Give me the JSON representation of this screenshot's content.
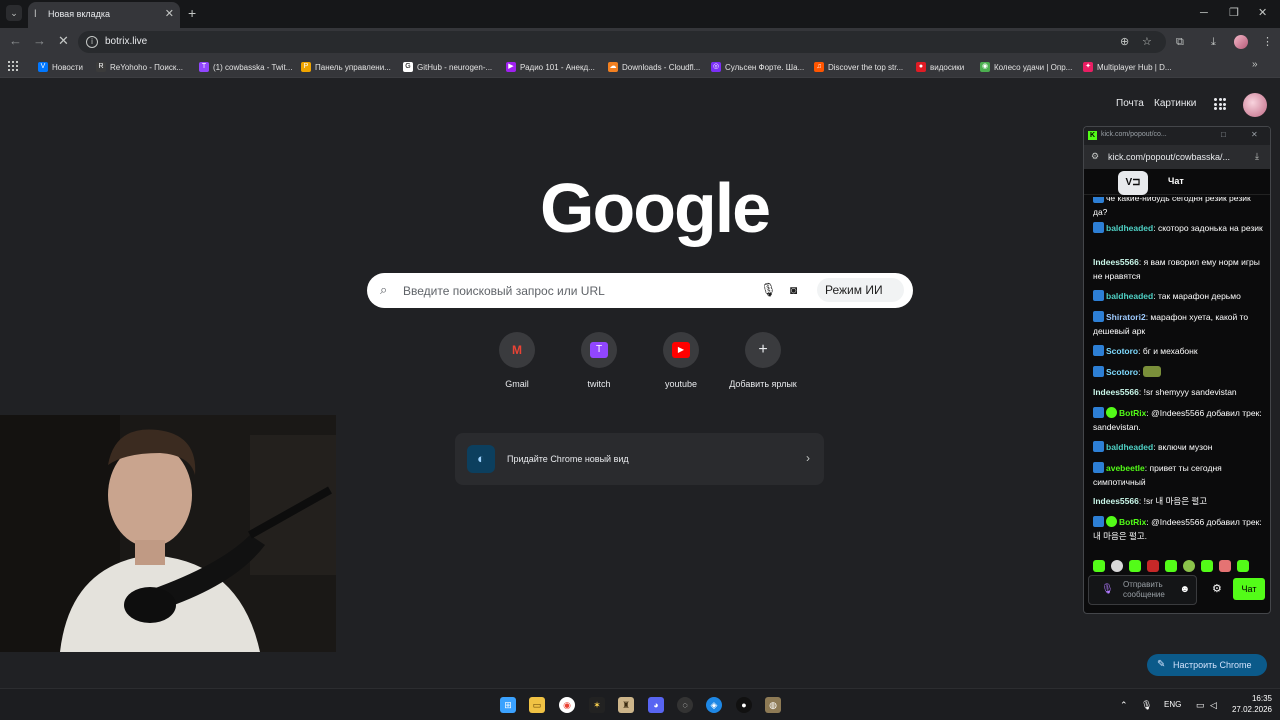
{
  "browser": {
    "tab_title": "Новая вкладка",
    "tab_close": "✕",
    "new_tab": "+",
    "win_min": "─",
    "win_max": "❐",
    "win_close": "✕",
    "url": "botrix.live",
    "back": "←",
    "forward": "→",
    "stop": "✕"
  },
  "bookmarks": [
    {
      "label": "Новости",
      "icon_color": "#0077ff",
      "icon": "VK"
    },
    {
      "label": "ReYohoho - Поиск...",
      "icon_color": "#3b3b3b",
      "icon": "R"
    },
    {
      "label": "(1) cowbasska - Twit...",
      "icon_color": "#9146ff",
      "icon": "T"
    },
    {
      "label": "Панель управлени...",
      "icon_color": "#f0a500",
      "icon": "P"
    },
    {
      "label": "GitHub - neurogen-...",
      "icon_color": "#ffffff",
      "icon": "G"
    },
    {
      "label": "Радио 101 - Анекд...",
      "icon_color": "#a020f0",
      "icon": "▶"
    },
    {
      "label": "Downloads - Cloudfl...",
      "icon_color": "#f38020",
      "icon": "☁"
    },
    {
      "label": "Сульсен Форте. Ша...",
      "icon_color": "#7b2ff7",
      "icon": "◎"
    },
    {
      "label": "Discover the top str...",
      "icon_color": "#ff5500",
      "icon": "♫"
    },
    {
      "label": "видосики",
      "icon_color": "#e01b24",
      "icon": "●"
    },
    {
      "label": "Колесо удачи | Опр...",
      "icon_color": "#4caf50",
      "icon": "◉"
    },
    {
      "label": "Multiplayer Hub | D...",
      "icon_color": "#e91e63",
      "icon": "✦"
    }
  ],
  "google": {
    "link_mail": "Почта",
    "link_images": "Картинки",
    "logo": "Google",
    "search_placeholder": "Введите поисковый запрос или URL",
    "ai_mode": "Режим ИИ",
    "shortcuts": [
      {
        "label": "Gmail",
        "glyph": "M",
        "color": "#ea4335"
      },
      {
        "label": "twitch",
        "glyph": "T",
        "color": "#9146ff"
      },
      {
        "label": "youtube",
        "glyph": "▶",
        "color": "#ff0000"
      },
      {
        "label": "Добавить ярлык",
        "glyph": "+",
        "color": "transparent"
      }
    ],
    "promo_text": "Придайте Chrome новый вид",
    "customize_label": "Настроить Chrome"
  },
  "popup": {
    "title_url": "kick.com/popout/co...",
    "url": "kick.com/popout/cowbasska/...",
    "logo": "V⊐",
    "chat_tab": "Чат",
    "messages": [
      {
        "user": "",
        "user_color": "#ffffff",
        "text": "че какие-нибудь сегодня резик резик да?",
        "badge": "sub"
      },
      {
        "user": "baldheaded",
        "user_color": "#4fd1c5",
        "text": "скоторо задонька на резик",
        "badge": "sub"
      },
      {
        "user": "Indees5566",
        "user_color": "#c9f7e9",
        "text": "я вам говорил ему норм игры не нравятся",
        "badge": "none"
      },
      {
        "user": "baldheaded",
        "user_color": "#4fd1c5",
        "text": "так марафон дерьмо",
        "badge": "sub"
      },
      {
        "user": "Shiratori2",
        "user_color": "#9ecbff",
        "text": "марафон хуета, какой то дешевый арк",
        "badge": "sub"
      },
      {
        "user": "Scotoro",
        "user_color": "#7fdbff",
        "text": "бг и мехабонк",
        "badge": "sub"
      },
      {
        "user": "Scotoro",
        "user_color": "#7fdbff",
        "text": "",
        "badge": "sub"
      },
      {
        "user": "Indees5566",
        "user_color": "#c9f7e9",
        "text": "!sr shemyyy sandevistan",
        "badge": "none"
      },
      {
        "user": "BotRix",
        "user_color": "#53fc18",
        "text": "@Indees5566 добавил трек: sandevistan.",
        "badge": "bot"
      },
      {
        "user": "baldheaded",
        "user_color": "#4fd1c5",
        "text": "включи музон",
        "badge": "sub"
      },
      {
        "user": "avebeetle",
        "user_color": "#53fc18",
        "text": "привет ты сегодня симпотичный",
        "badge": "sub"
      },
      {
        "user": "Indees5566",
        "user_color": "#c9f7e9",
        "text": "!sr 내 마음은 펄고",
        "badge": "none"
      },
      {
        "user": "BotRix",
        "user_color": "#53fc18",
        "text": "@Indees5566 добавил трек: 내 마음은 펄고.",
        "badge": "bot"
      }
    ],
    "input_placeholder": "Отправить сообщение",
    "send_label": "Чат"
  },
  "taskbar": {
    "lang": "ENG",
    "time": "16:35",
    "date": "27.02.2026"
  }
}
